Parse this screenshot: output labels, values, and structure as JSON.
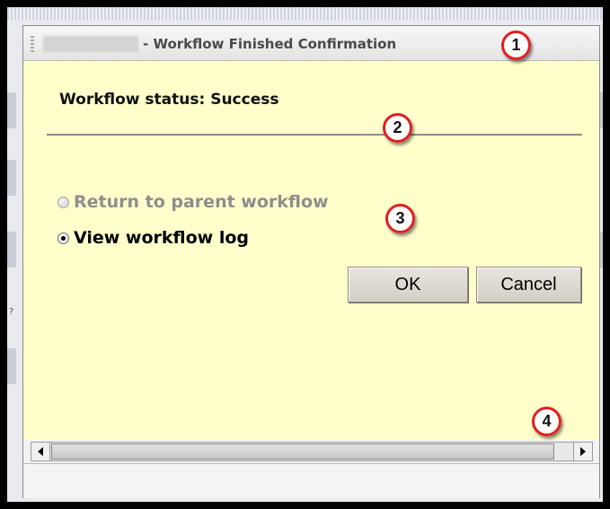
{
  "window": {
    "title": "- Workflow Finished Confirmation"
  },
  "main": {
    "status": "Workflow status: Success",
    "options": [
      {
        "label": "Return to parent workflow",
        "enabled": false,
        "checked": false
      },
      {
        "label": "View workflow log",
        "enabled": true,
        "checked": true
      }
    ],
    "ok_label": "OK",
    "cancel_label": "Cancel"
  },
  "callouts": [
    "1",
    "2",
    "3",
    "4"
  ],
  "colors": {
    "content_background": "#ffffcc",
    "callout_border": "#e02020",
    "disabled_text": "#8e8e8e"
  }
}
